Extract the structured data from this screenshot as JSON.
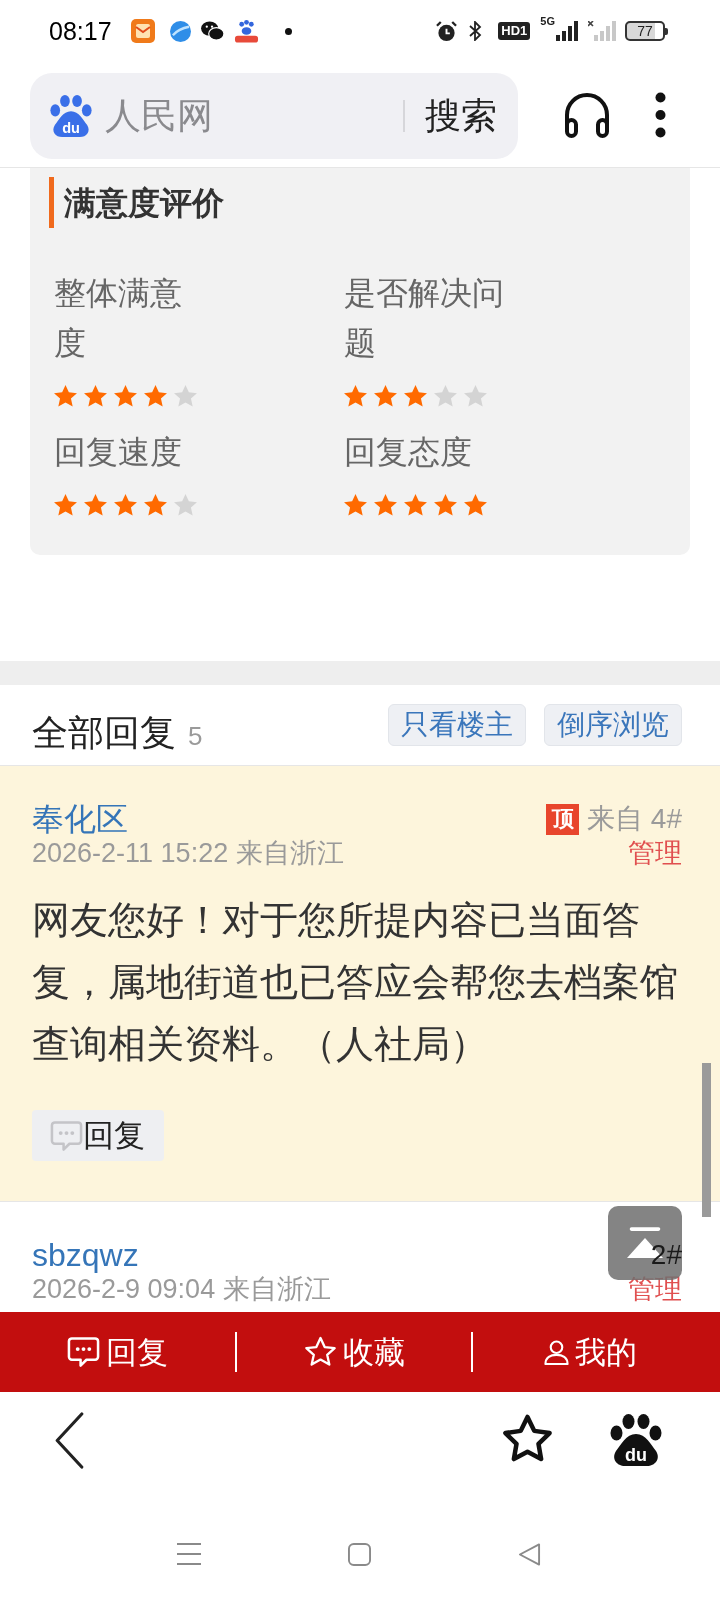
{
  "status_bar": {
    "time": "08:17",
    "hd_label": "HD1",
    "network": "5G",
    "battery": "77"
  },
  "address_bar": {
    "logo_text": "du",
    "title": "人民网",
    "search_button": "搜索"
  },
  "rating_panel": {
    "title": "满意度评价",
    "items": [
      {
        "label": "整体满意度",
        "stars": 4
      },
      {
        "label": "是否解决问题",
        "stars": 3
      },
      {
        "label": "回复速度",
        "stars": 4
      },
      {
        "label": "回复态度",
        "stars": 5
      }
    ]
  },
  "replies": {
    "title": "全部回复",
    "count": "5",
    "filters": [
      "只看楼主",
      "倒序浏览"
    ],
    "items": [
      {
        "author": "奉化区",
        "time": "2026-2-11 15:22 来自浙江",
        "badge": "顶",
        "floor": "来自 4#",
        "manage": "管理",
        "highlighted": true,
        "body": "网友您好！对于您所提内容已当面答复，属地街道也已答应会帮您去档案馆查询相关资料。（人社局）",
        "reply_button": "回复"
      },
      {
        "author": "sbzqwz",
        "time": "2026-2-9 09:04 来自浙江",
        "floor": "2#",
        "manage": "管理",
        "highlighted": false
      }
    ]
  },
  "action_bar": [
    {
      "kind": "reply",
      "label": "回复"
    },
    {
      "kind": "favorite",
      "label": "收藏"
    },
    {
      "kind": "profile",
      "label": "我的"
    }
  ],
  "browser_bar": {
    "logo_text": "du"
  }
}
